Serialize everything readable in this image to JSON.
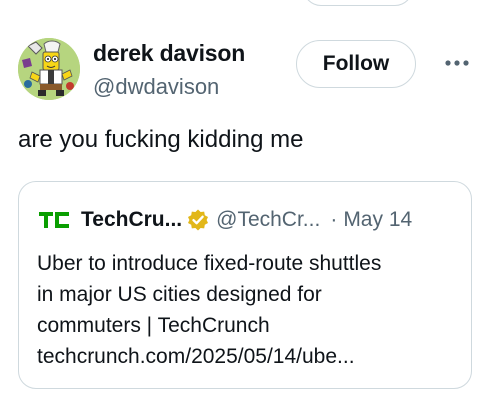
{
  "post": {
    "author": {
      "display_name": "derek davison",
      "handle": "@dwdavison",
      "avatar_icon": "cartoon-avatar"
    },
    "follow_label": "Follow",
    "more_icon": "ellipsis-icon",
    "text": "are you fucking kidding me"
  },
  "quote": {
    "logo": "TC",
    "name": "TechCru...",
    "verified_icon": "gold-verified-badge",
    "handle": "@TechCr...",
    "separator": "·",
    "date": "May 14",
    "body_lines": [
      "Uber to introduce fixed-route shuttles",
      "in major US cities designed for",
      "commuters | TechCrunch",
      "techcrunch.com/2025/05/14/ube..."
    ]
  },
  "colors": {
    "text_primary": "#0f1419",
    "text_secondary": "#536471",
    "border": "#cfd9de",
    "techcrunch_green": "#0a9e01",
    "verified_gold": "#e2b719"
  }
}
